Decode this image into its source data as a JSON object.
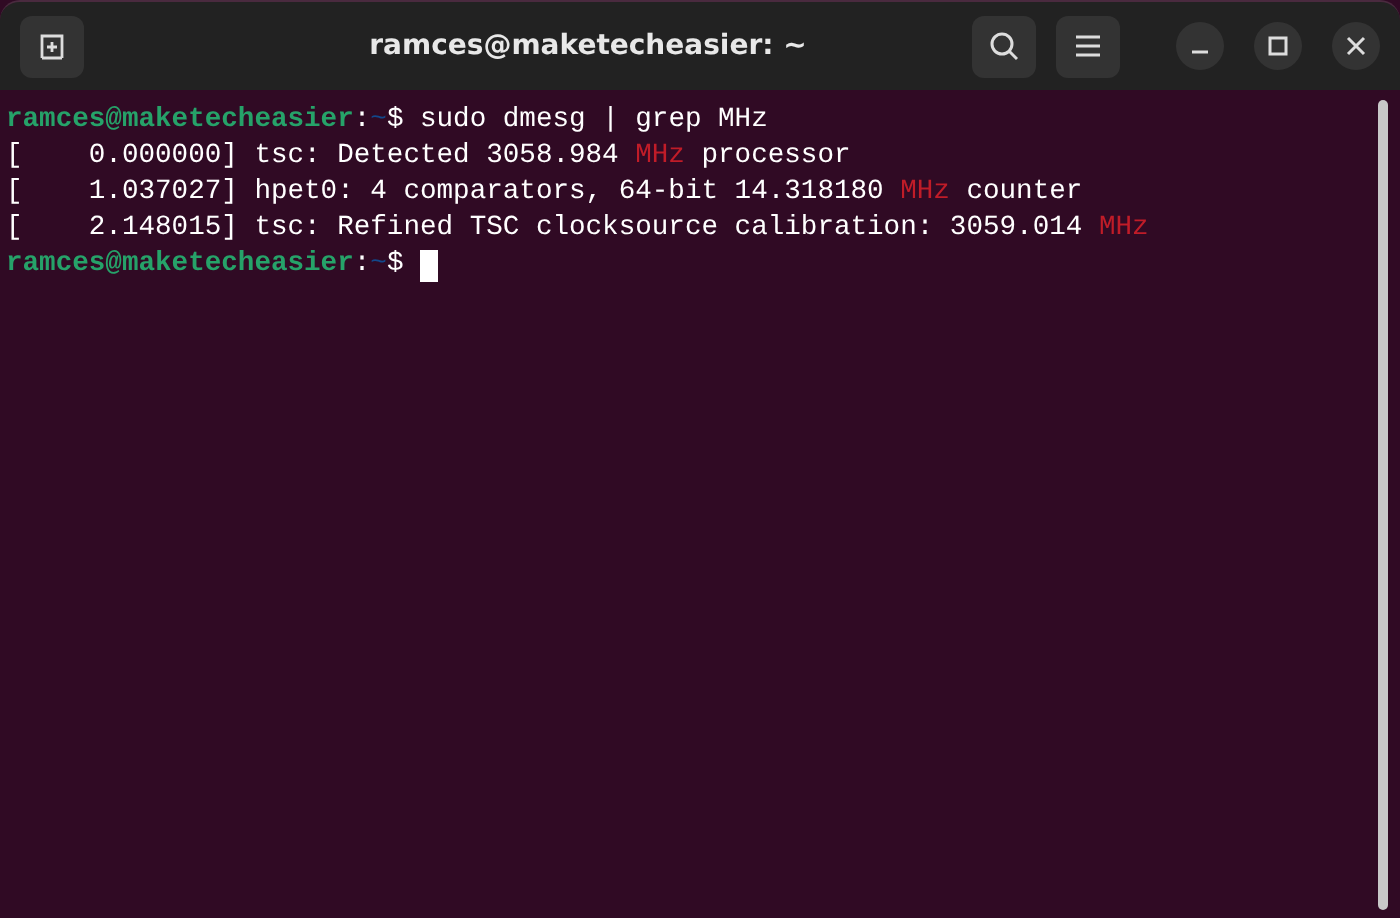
{
  "window": {
    "title": "ramces@maketecheasier: ~"
  },
  "terminal": {
    "lines": [
      {
        "segments": [
          {
            "kind": "user",
            "text": "ramces@maketecheasier"
          },
          {
            "kind": "plain",
            "text": ":"
          },
          {
            "kind": "path",
            "text": "~"
          },
          {
            "kind": "plain",
            "text": "$ sudo dmesg | grep MHz"
          }
        ],
        "cursor": false
      },
      {
        "segments": [
          {
            "kind": "plain",
            "text": "[    0.000000] tsc: Detected 3058.984 "
          },
          {
            "kind": "match",
            "text": "MHz"
          },
          {
            "kind": "plain",
            "text": " processor"
          }
        ],
        "cursor": false
      },
      {
        "segments": [
          {
            "kind": "plain",
            "text": "[    1.037027] hpet0: 4 comparators, 64-bit 14.318180 "
          },
          {
            "kind": "match",
            "text": "MHz"
          },
          {
            "kind": "plain",
            "text": " counter"
          }
        ],
        "cursor": false
      },
      {
        "segments": [
          {
            "kind": "plain",
            "text": "[    2.148015] tsc: Refined TSC clocksource calibration: 3059.014 "
          },
          {
            "kind": "match",
            "text": "MHz"
          }
        ],
        "cursor": false
      },
      {
        "segments": [
          {
            "kind": "user",
            "text": "ramces@maketecheasier"
          },
          {
            "kind": "plain",
            "text": ":"
          },
          {
            "kind": "path",
            "text": "~"
          },
          {
            "kind": "plain",
            "text": "$ "
          }
        ],
        "cursor": true
      }
    ]
  }
}
